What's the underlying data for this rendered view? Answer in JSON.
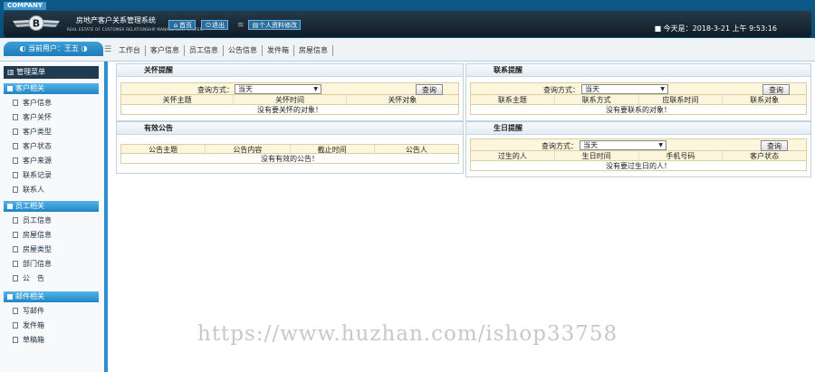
{
  "header": {
    "company": "COMPANY",
    "logo_letter": "B",
    "system_title": "房地产客户关系管理系统",
    "system_subtitle": "REAL ESTATE OF CUSTOMER RELATIONSHIP MANAGEMENT SYSTEM",
    "nav": {
      "home": "首页",
      "logout": "退出",
      "profile": "个人资料修改"
    },
    "clock": "■ 今天是：2018-3-21 上午 9:53:16"
  },
  "toolbar": {
    "user": "当前用户：王五",
    "tabs": [
      "工作台",
      "客户信息",
      "员工信息",
      "公告信息",
      "发件箱",
      "房屋信息"
    ]
  },
  "sidebar": {
    "title": "管理菜单",
    "sections": [
      {
        "title": "客户相关",
        "items": [
          "客户信息",
          "客户关怀",
          "客户类型",
          "客户状态",
          "客户来源",
          "联系记录",
          "联系人"
        ]
      },
      {
        "title": "员工相关",
        "items": [
          "员工信息",
          "房屋信息",
          "房屋类型",
          "部门信息",
          "公　告"
        ]
      },
      {
        "title": "邮件相关",
        "items": [
          "写邮件",
          "发件箱",
          "草稿箱"
        ]
      }
    ]
  },
  "panels": {
    "care": {
      "title": "关怀提醒",
      "query_label": "查询方式：",
      "query_value": "当天",
      "btn": "查询",
      "cols": [
        "关怀主题",
        "关怀时间",
        "关怀对象"
      ],
      "empty": "没有要关怀的对象！"
    },
    "contact": {
      "title": "联系提醒",
      "query_label": "查询方式：",
      "query_value": "当天",
      "btn": "查询",
      "cols": [
        "联系主题",
        "联系方式",
        "应联系时间",
        "联系对象"
      ],
      "empty": "没有要联系的对象！"
    },
    "notice": {
      "title": "有效公告",
      "cols": [
        "公告主题",
        "公告内容",
        "截止时间",
        "公告人"
      ],
      "empty": "没有有效的公告！"
    },
    "birthday": {
      "title": "生日提醒",
      "query_label": "查询方式：",
      "query_value": "当天",
      "btn": "查询",
      "cols": [
        "过生的人",
        "生日时间",
        "手机号码",
        "客户状态"
      ],
      "empty": "没有要过生日的人！"
    }
  },
  "watermark": "https://www.huzhan.com/ishop33758"
}
